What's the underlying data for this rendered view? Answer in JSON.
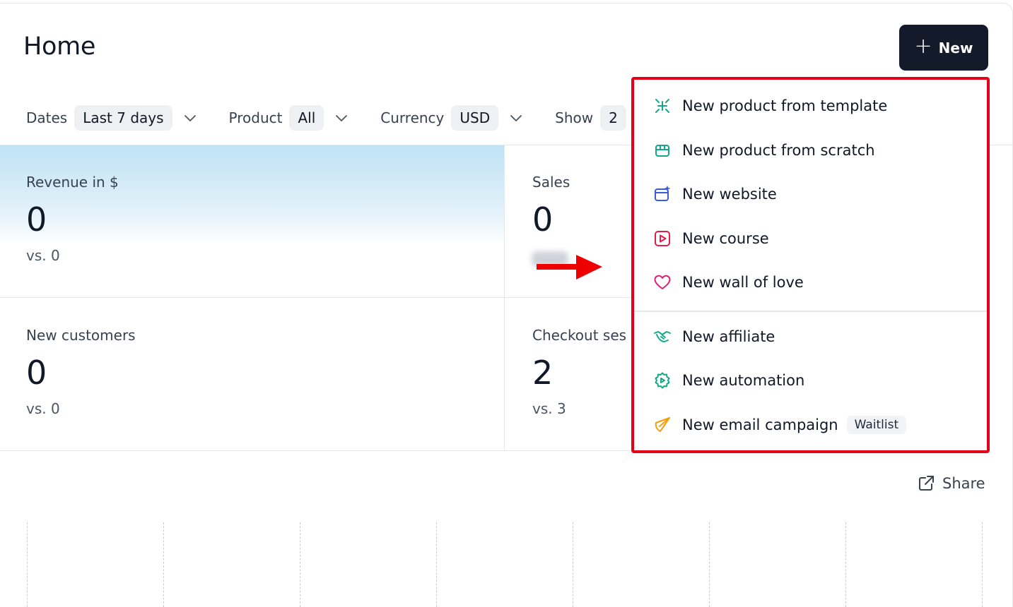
{
  "header": {
    "title": "Home",
    "new_button_label": "New",
    "new_button_icon": "plus-icon"
  },
  "filters": [
    {
      "label": "Dates",
      "value": "Last 7 days"
    },
    {
      "label": "Product",
      "value": "All"
    },
    {
      "label": "Currency",
      "value": "USD"
    },
    {
      "label": "Show",
      "value": "2"
    }
  ],
  "cards": {
    "revenue": {
      "label": "Revenue in $",
      "value": "0",
      "vs": "vs. 0"
    },
    "sales": {
      "label": "Sales",
      "value": "0",
      "vs": ""
    },
    "new_customers": {
      "label": "New customers",
      "value": "0",
      "vs": "vs. 0"
    },
    "checkout": {
      "label": "Checkout ses",
      "value": "2",
      "vs": "vs. 3"
    }
  },
  "menu": {
    "items": [
      {
        "label": "New product from template",
        "icon": "sparkle-icon",
        "color": "#14a88a"
      },
      {
        "label": "New product from scratch",
        "icon": "box-icon",
        "color": "#14a88a"
      },
      {
        "label": "New website",
        "icon": "website-icon",
        "color": "#3b5bdb"
      },
      {
        "label": "New course",
        "icon": "play-icon",
        "color": "#e11d48"
      },
      {
        "label": "New wall of love",
        "icon": "heart-icon",
        "color": "#e11d70"
      },
      {
        "label": "New affiliate",
        "icon": "handshake-icon",
        "color": "#14a88a"
      },
      {
        "label": "New automation",
        "icon": "automation-gear-icon",
        "color": "#14a88a"
      },
      {
        "label": "New email campaign",
        "icon": "paper-plane-icon",
        "color": "#f59e0b",
        "badge": "Waitlist"
      }
    ]
  },
  "share": {
    "label": "Share"
  },
  "colors": {
    "primary_button": "#131a2a",
    "highlight_border": "#e3001b",
    "arrow": "#ee0000"
  }
}
